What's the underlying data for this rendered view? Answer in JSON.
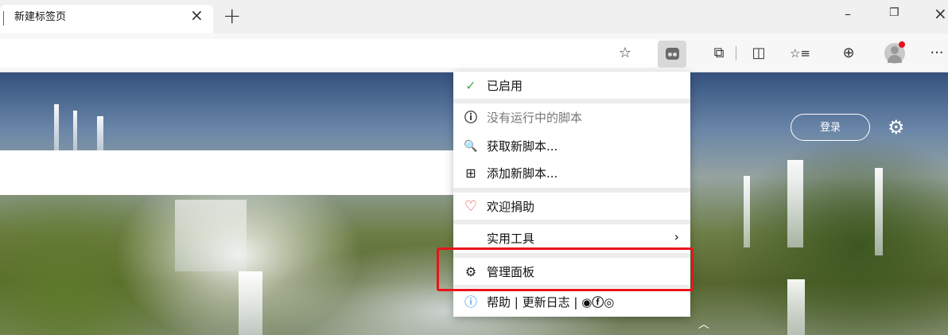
{
  "tab": {
    "title": "新建标签页",
    "close": "×",
    "new": "+"
  },
  "window": {
    "minimize": "–",
    "maximize": "❐",
    "close": "×"
  },
  "toolbar": {
    "favorite_add": "☆",
    "extensions": "⧉",
    "split": "◫",
    "favorites": "☆≡",
    "collections": "⊕",
    "more": "···"
  },
  "newtab": {
    "login_label": "登录",
    "settings_icon": "⚙",
    "scroll_icon": "︿"
  },
  "menu": {
    "enabled": {
      "icon": "✓",
      "label": "已启用",
      "icon_color": "#4caf50"
    },
    "no_scripts": {
      "icon": "ⓘ",
      "label": "没有运行中的脚本"
    },
    "get_scripts": {
      "icon": "🔍",
      "label": "获取新脚本..."
    },
    "add_script": {
      "icon": "⊞",
      "label": "添加新脚本..."
    },
    "donate": {
      "icon": "♡",
      "label": "欢迎捐助",
      "icon_color": "#e53935"
    },
    "utilities": {
      "label": "实用工具",
      "arrow": "›"
    },
    "dashboard": {
      "icon": "⚙",
      "label": "管理面板"
    },
    "help": {
      "icon": "ⓘ",
      "label": "帮助 | 更新日志 | ",
      "links": "◉ⓕ◎",
      "icon_color": "#1e88e5"
    }
  },
  "colors": {
    "highlight": "#e8141b"
  }
}
